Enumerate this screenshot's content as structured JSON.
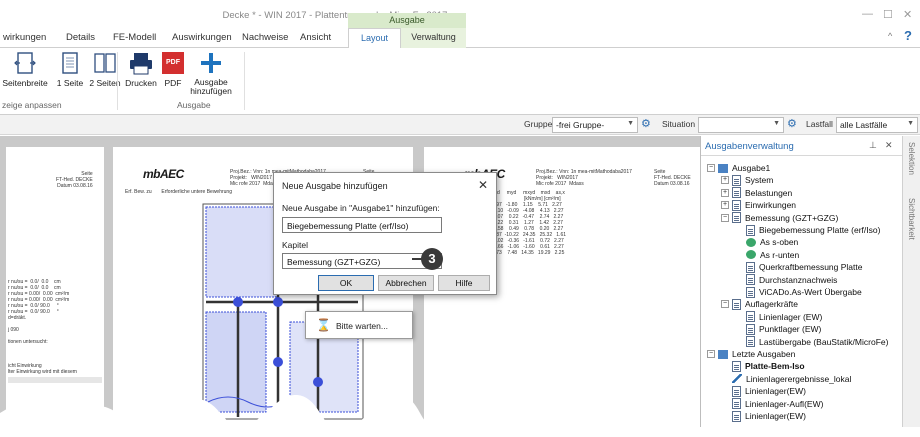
{
  "window": {
    "title": "Decke * - WIN 2017 - Plattentragwerk - MicroFe 2017",
    "context_tab": "Ausgabe"
  },
  "tabs": [
    "wirkungen",
    "Details",
    "FE-Modell",
    "Auswirkungen",
    "Nachweise",
    "Ansicht",
    "Layout",
    "Verwaltung"
  ],
  "ribbon": {
    "view_buttons": [
      "Seitenbreite",
      "1 Seite",
      "2 Seiten"
    ],
    "view_group": "zeige anpassen",
    "print_label": "Drucken",
    "pdf_label": "PDF",
    "pdf_icon_text": "PDF",
    "add_label": "Ausgabe hinzufügen",
    "output_group": "Ausgabe"
  },
  "filterbar": {
    "gruppe_label": "Gruppe",
    "gruppe_value": "-frei Gruppe-",
    "situation_label": "Situation",
    "situation_value": "",
    "lastfall_label": "Lastfall",
    "lastfall_value": "alle Lastfälle"
  },
  "pages": {
    "header_lines": "Proj.Bez.: Vnn: 1n mea-mitMathodaba2017\nProjekt:   WIN2017\nMic rofe 2017  Mdass",
    "header_right": "Seite\nFT-Hed. DECKE\nDatum 03.08.16",
    "left_text": "r nu/su =  0.0/  0.0    cm\nr nu/su =  0.0/  0.0    cm\nr nu/su = 0.00/  0.00  cm²/m\nr nu/su = 0.00/  0.00  cm²/m\nr nu/su =  0.0/ 90.0     °\nr nu/su =  0.0/ 90.0     °\nd=dräkt.\n\nj 090\n\ntionen untersucht:\n\n\n\nicht Einwirkung\nlter Einwirkung wird mit diesem",
    "table_header": "Erf. Bew. zu       Erforderliche untere Bewehrung",
    "right_table": "    y      mxd     myd     mxyd    mxd    as,x\n   [m]                            [kNm/m] [cm²/m]\n  6.08    2.97   -1.80    1.15    5.71   2.27\n 13.50    0.10   -0.09   -4.08    4.13   2.27\n 13.60    2.07    0.22   -0.47    2.74   2.27\n 13.50    0.22    0.31    1.27    1.42   2.27\n 13.73   -0.58    0.49    0.78    0.20   2.27\n  2.32    0.87  -10.22   24.35   25.32   1.61\n 13.50   -0.02   -0.36   -1.61    0.72   2.27\n 13.06   -0.66   -1.06   -1.60    0.61   2.27\n  5.00    4.73    7.48   14.35   19.29   2.25"
  },
  "dialog": {
    "title": "Neue Ausgabe hinzufügen",
    "prompt": "Neue Ausgabe in \"Ausgabe1\" hinzufügen:",
    "name_value": "Biegebemessung Platte (erf/Iso)",
    "chapter_label": "Kapitel",
    "chapter_value": "Bemessung (GZT+GZG)",
    "ok": "OK",
    "cancel": "Abbrechen",
    "help": "Hilfe"
  },
  "wait_text": "Bitte warten...",
  "badge": "3",
  "panel": {
    "title": "Ausgabenverwaltung",
    "pin": "⊥",
    "close": "✕",
    "tree": [
      {
        "label": "Ausgabe1",
        "level": 0,
        "exp": "−",
        "icon": "folder"
      },
      {
        "label": "System",
        "level": 1,
        "exp": "+",
        "icon": "doc"
      },
      {
        "label": "Belastungen",
        "level": 1,
        "exp": "+",
        "icon": "doc"
      },
      {
        "label": "Einwirkungen",
        "level": 1,
        "exp": "+",
        "icon": "doc"
      },
      {
        "label": "Bemessung (GZT+GZG)",
        "level": 1,
        "exp": "−",
        "icon": "doc"
      },
      {
        "label": "Biegebemessung Platte (erf/Iso)",
        "level": 2,
        "icon": "doc"
      },
      {
        "label": "As s-oben",
        "level": 2,
        "icon": "rebar"
      },
      {
        "label": "As r-unten",
        "level": 2,
        "icon": "rebar"
      },
      {
        "label": "Querkraftbemessung Platte",
        "level": 2,
        "icon": "doc"
      },
      {
        "label": "Durchstanznachweis",
        "level": 2,
        "icon": "doc"
      },
      {
        "label": "ViCADo.As-Wert Übergabe",
        "level": 2,
        "icon": "doc"
      },
      {
        "label": "Auflagerkräfte",
        "level": 1,
        "exp": "−",
        "icon": "doc"
      },
      {
        "label": "Linienlager (EW)",
        "level": 2,
        "icon": "doc"
      },
      {
        "label": "Punktlager (EW)",
        "level": 2,
        "icon": "doc"
      },
      {
        "label": "Lastübergabe (BauStatik/MicroFe)",
        "level": 2,
        "icon": "doc"
      },
      {
        "label": "Letzte Ausgaben",
        "level": 0,
        "exp": "−",
        "icon": "folder"
      },
      {
        "label": "Platte-Bem-Iso",
        "level": 1,
        "icon": "doc",
        "bold": true
      },
      {
        "label": "Linienlagerergebnisse_lokal",
        "level": 1,
        "icon": "pen"
      },
      {
        "label": "Linienlager(EW)",
        "level": 1,
        "icon": "doc"
      },
      {
        "label": "Linienlager-Aufl(EW)",
        "level": 1,
        "icon": "doc"
      },
      {
        "label": "Linienlager(EW)",
        "level": 1,
        "icon": "doc"
      }
    ]
  },
  "side_tabs": [
    "Selektion",
    "Sichtbarkeit"
  ],
  "colors": {
    "accent": "#2b6cb0",
    "context_green": "#d9eacb",
    "mesh_blue": "#3b4fd8"
  }
}
